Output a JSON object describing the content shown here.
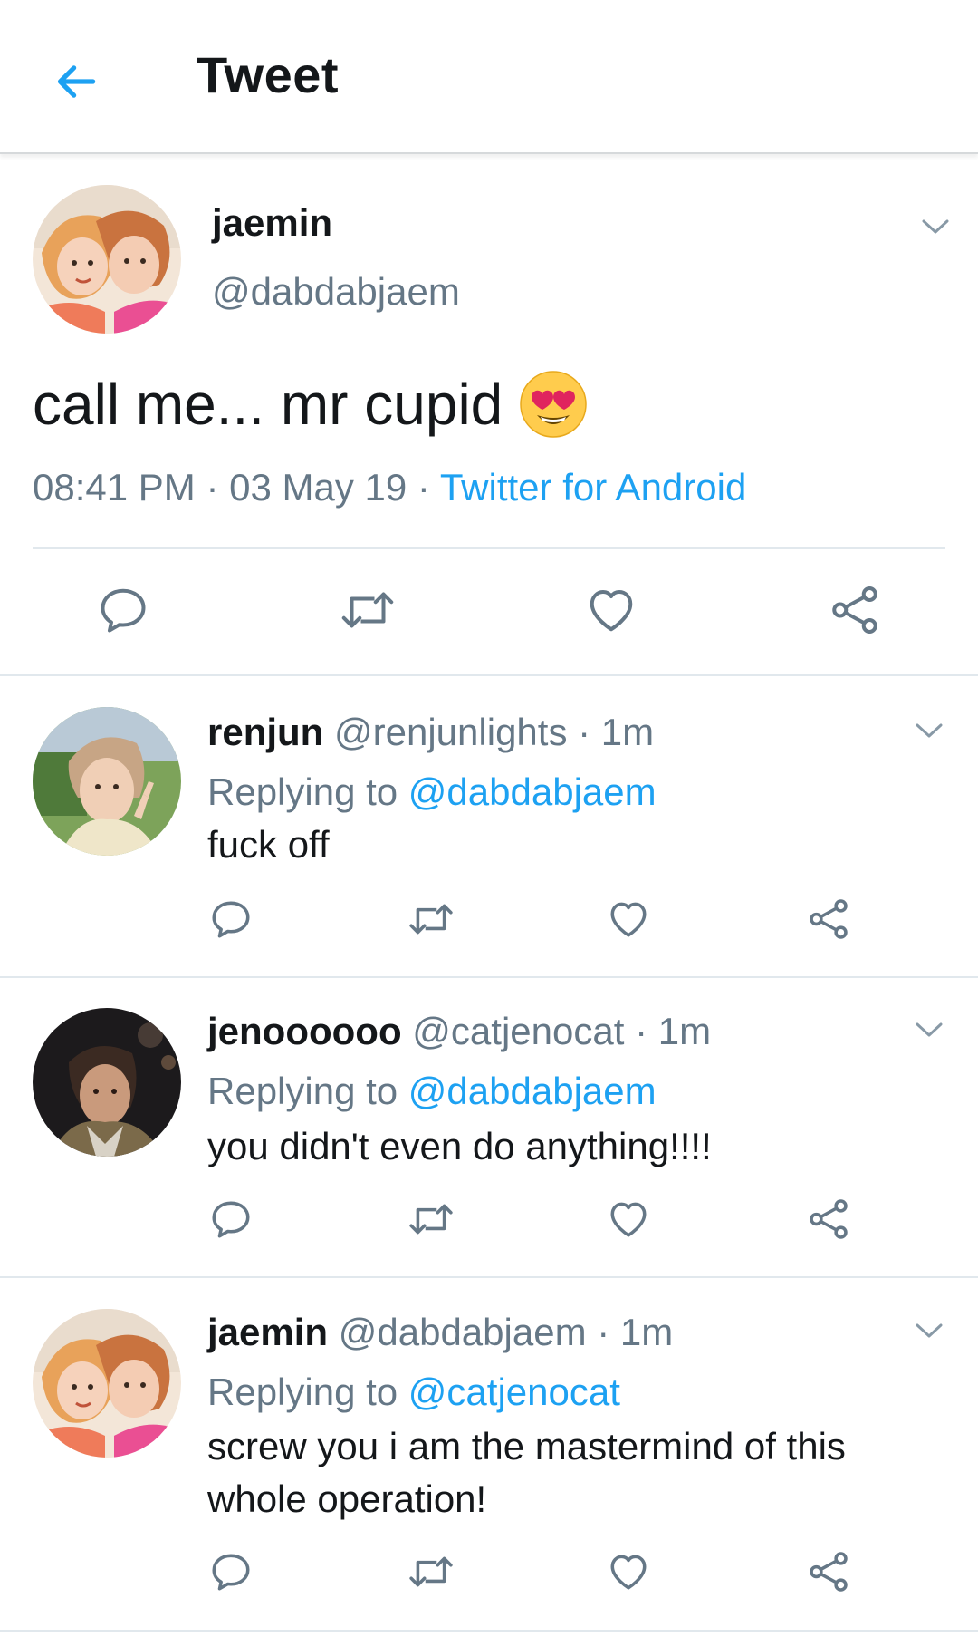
{
  "header": {
    "title": "Tweet",
    "back_icon": "arrow-left-icon",
    "accent": "#1da1f2"
  },
  "main_tweet": {
    "name": "jaemin",
    "handle": "@dabdabjaem",
    "text": "call me... mr cupid",
    "emoji": "heart-eyes-emoji",
    "time": "08:41 PM",
    "date": "03 May 19",
    "client": "Twitter for Android",
    "separator": "·"
  },
  "replies": [
    {
      "name": "renjun",
      "handle": "@renjunlights",
      "age": "1m",
      "replying_label": "Replying to",
      "replying_to": "@dabdabjaem",
      "text": "fuck off"
    },
    {
      "name": "jenoooooo",
      "handle": "@catjenocat",
      "age": "1m",
      "replying_label": "Replying to",
      "replying_to": "@dabdabjaem",
      "text": "you didn't even do anything!!!!"
    },
    {
      "name": "jaemin",
      "handle": "@dabdabjaem",
      "age": "1m",
      "replying_label": "Replying to",
      "replying_to": "@catjenocat",
      "text": "screw you i am the mastermind of this whole operation!"
    }
  ],
  "icons": {
    "reply": "reply-icon",
    "retweet": "retweet-icon",
    "like": "heart-icon",
    "share": "share-icon",
    "menu": "chevron-down-icon"
  },
  "colors": {
    "text_primary": "#14171a",
    "text_secondary": "#657786",
    "link": "#1da1f2",
    "icon": "#657786",
    "divider": "#e1e8ed"
  }
}
